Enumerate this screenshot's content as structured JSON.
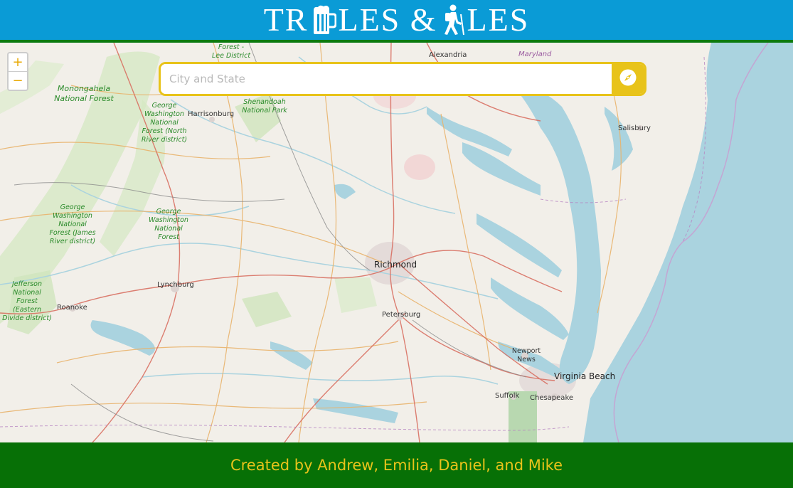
{
  "header": {
    "logo_part1": "TR",
    "logo_part2": "LES & ",
    "logo_part3": "LES",
    "logo_icons": [
      "beer-mug-icon",
      "hiker-icon"
    ]
  },
  "map": {
    "zoom_in_label": "+",
    "zoom_out_label": "−",
    "search": {
      "placeholder": "City and State",
      "value": ""
    },
    "search_button_icon": "compass-icon",
    "labels": {
      "alexandria": "Alexandria",
      "maryland": "Maryland",
      "forest_lee": "Forest -\nLee District",
      "monongahela": "Monongahela National Forest",
      "gw_north": "George Washington National Forest (North River district)",
      "harrisonburg": "Harrisonburg",
      "shenandoah": "Shenandoah National Park",
      "salisbury": "Salisbury",
      "gw_james": "George Washington National Forest (James River district)",
      "gw_forest": "George Washington National Forest",
      "richmond": "Richmond",
      "lynchburg": "Lynchburg",
      "jefferson": "Jefferson National Forest (Eastern Divide district)",
      "roanoke": "Roanoke",
      "petersburg": "Petersburg",
      "newport_news": "Newport News",
      "virginia_beach": "Virginia Beach",
      "suffolk": "Suffolk",
      "chesapeake": "Chesapeake"
    }
  },
  "footer": {
    "prefix": "Created by ",
    "names": "Andrew, Emilia, Daniel, and Mike"
  },
  "colors": {
    "header_bg": "#0a9bd6",
    "header_border": "#0b7a10",
    "footer_bg": "#077006",
    "accent_yellow": "#e8c31a",
    "water": "#aad3df",
    "land": "#f2efe9",
    "forest": "#c8e6b0"
  }
}
